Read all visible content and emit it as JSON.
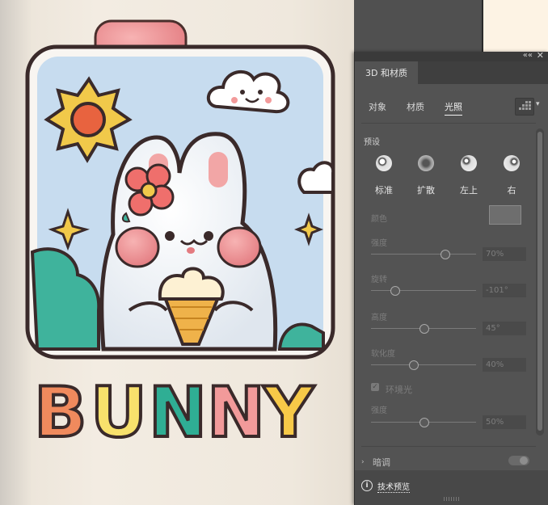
{
  "artwork": {
    "wordmark": "BUNNY",
    "letter_colors": [
      "#f08a5d",
      "#f8e16c",
      "#2fae94",
      "#f29a9a",
      "#f7c948"
    ]
  },
  "panel": {
    "title": "3D 和材质",
    "collapse_glyph": "««",
    "close_glyph": "✕",
    "tabs": [
      "对象",
      "材质",
      "光照"
    ],
    "active_tab": "光照",
    "presets_label": "预设",
    "presets": [
      "标准",
      "扩散",
      "左上",
      "右"
    ],
    "color_label": "颜色",
    "color_value": "#6e6e6e",
    "intensity": {
      "label": "强度",
      "value": "70%",
      "fraction": 0.7
    },
    "rotation": {
      "label": "旋转",
      "value": "-101°",
      "fraction": 0.22
    },
    "height": {
      "label": "高度",
      "value": "45°",
      "fraction": 0.5
    },
    "softness": {
      "label": "软化度",
      "value": "40%",
      "fraction": 0.4
    },
    "ambient": {
      "label": "环境光",
      "checked": true,
      "check_glyph": "✓"
    },
    "ambient_intensity": {
      "label": "强度",
      "value": "50%",
      "fraction": 0.5
    },
    "shadow_arrow": "›",
    "shadow_label": "暗调",
    "info_glyph": "i",
    "tech_preview": "技术预览"
  },
  "colors": {
    "panel_bg": "#535353",
    "accent_text": "#f2f2f2",
    "art_border": "#3a2a2a",
    "sky": "#c7dcef"
  },
  "icons": [
    "collapse-icon",
    "close-icon",
    "render-icon",
    "chevron-down-icon",
    "info-icon"
  ]
}
